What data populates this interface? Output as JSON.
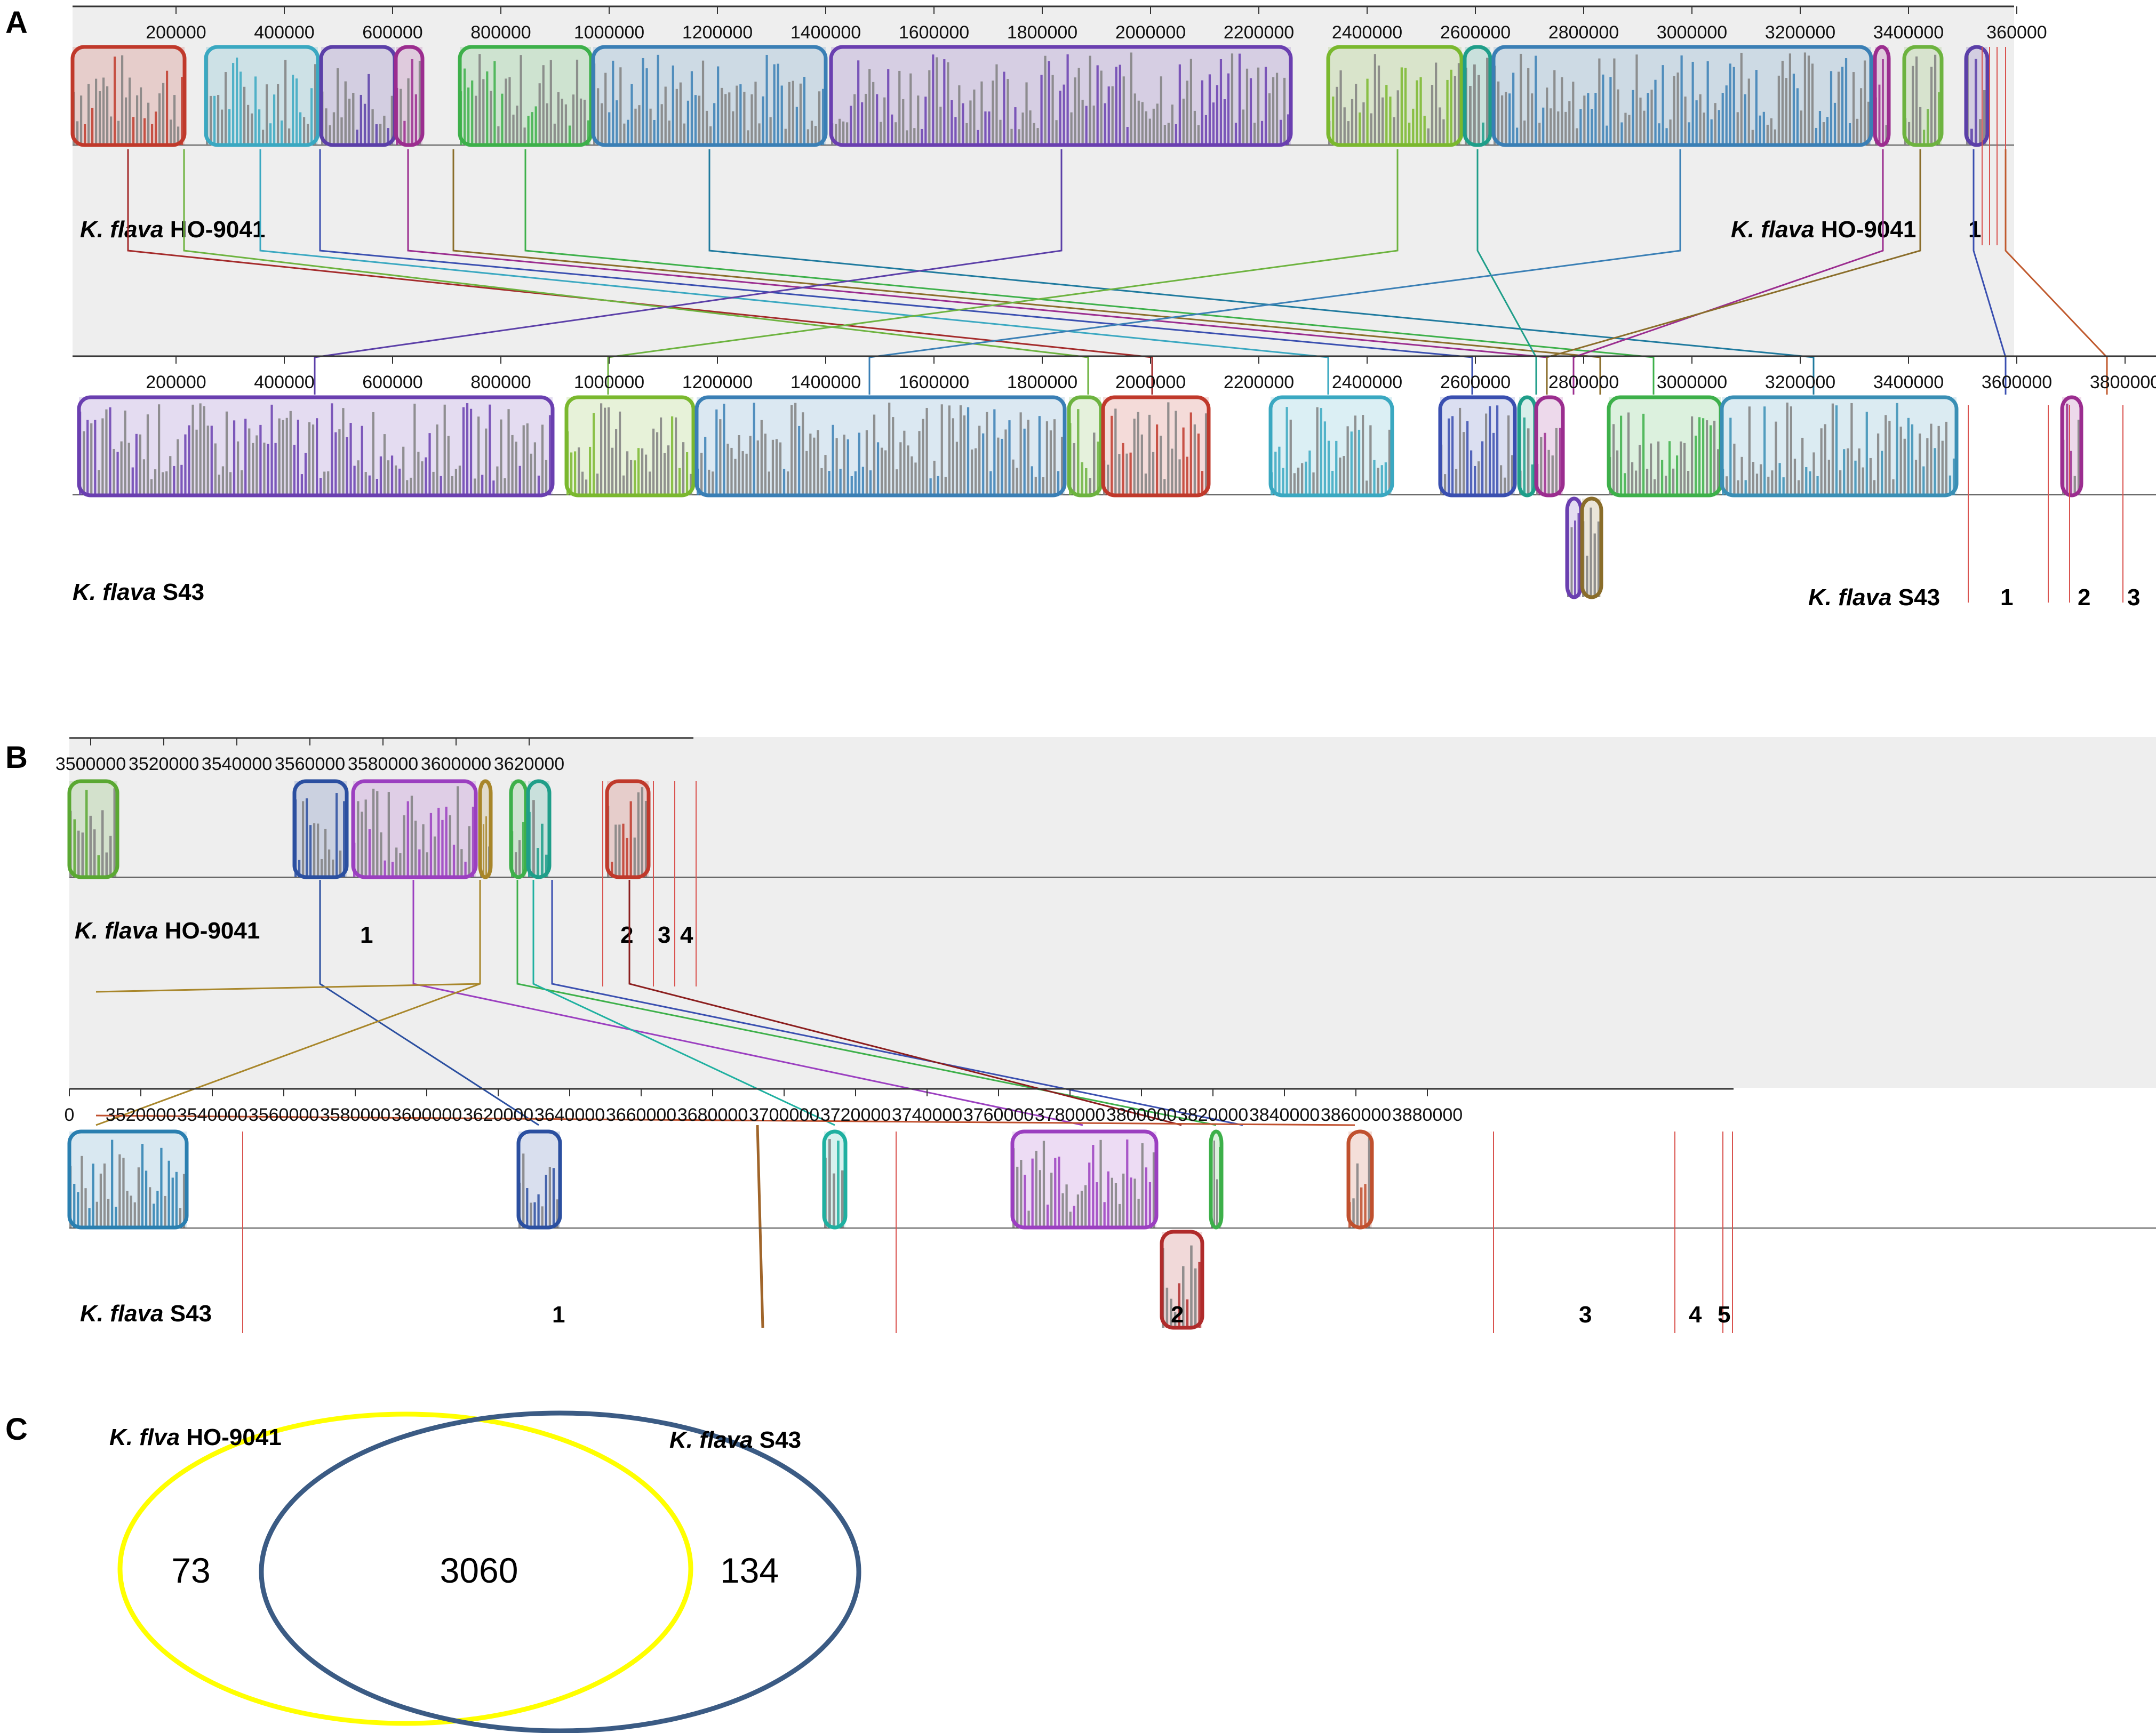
{
  "panels": {
    "A": {
      "letter": "A",
      "genome_top": {
        "label_italic": "K. flava",
        "label_strain": "HO-9041"
      },
      "genome_top_right": {
        "label_italic": "K. flava",
        "label_strain": "HO-9041",
        "marker": "1"
      },
      "genome_bottom": {
        "label_italic": "K. flava",
        "label_strain": "S43"
      },
      "genome_bottom_right": {
        "label_italic": "K. flava",
        "label_strain": "S43",
        "markers": [
          "1",
          "2",
          "3"
        ]
      },
      "top_ruler": [
        "200000",
        "400000",
        "600000",
        "800000",
        "1000000",
        "1200000",
        "1400000",
        "1600000",
        "1800000",
        "2000000",
        "2200000",
        "2400000",
        "2600000",
        "2800000",
        "3000000",
        "3200000",
        "3400000",
        "360000"
      ],
      "bottom_ruler": [
        "200000",
        "400000",
        "600000",
        "800000",
        "1000000",
        "1200000",
        "1400000",
        "1600000",
        "1800000",
        "2000000",
        "2200000",
        "2400000",
        "2600000",
        "2800000",
        "3000000",
        "3200000",
        "3400000",
        "3600000",
        "3800000"
      ]
    },
    "B": {
      "letter": "B",
      "genome_top": {
        "label_italic": "K. flava",
        "label_strain": "HO-9041",
        "markers": [
          "1",
          "2",
          "3",
          "4"
        ]
      },
      "genome_bottom": {
        "label_italic": "K. flava",
        "label_strain": "S43",
        "markers": [
          "1",
          "2",
          "3",
          "4",
          "5"
        ]
      },
      "top_ruler": [
        "3500000",
        "3520000",
        "3540000",
        "3560000",
        "3580000",
        "3600000",
        "3620000"
      ],
      "bottom_ruler": [
        "0",
        "3520000",
        "3540000",
        "3560000",
        "3580000",
        "3600000",
        "3620000",
        "3640000",
        "3660000",
        "3680000",
        "3700000",
        "3720000",
        "3740000",
        "3760000",
        "3780000",
        "3800000",
        "3820000",
        "3840000",
        "3860000",
        "3880000"
      ]
    },
    "C": {
      "letter": "C",
      "set_a": {
        "label_italic": "K. flva",
        "label_strain": "HO-9041",
        "unique": "73",
        "color": "#ffff00"
      },
      "set_b": {
        "label_italic": "K. flava",
        "label_strain": "S43",
        "unique": "134",
        "color": "#3b5b84"
      },
      "shared": "3060"
    }
  },
  "colors": {
    "panel_bg": "#eeeeee",
    "histogram": "#808080",
    "lcb_palette": [
      "#c0392b",
      "#3aa8c1",
      "#5b3fa8",
      "#9b2d8f",
      "#6db33f",
      "#3a7fb5",
      "#8a6d2a",
      "#1f9e89",
      "#2b4fa0",
      "#c05a2e",
      "#d4b826"
    ]
  }
}
